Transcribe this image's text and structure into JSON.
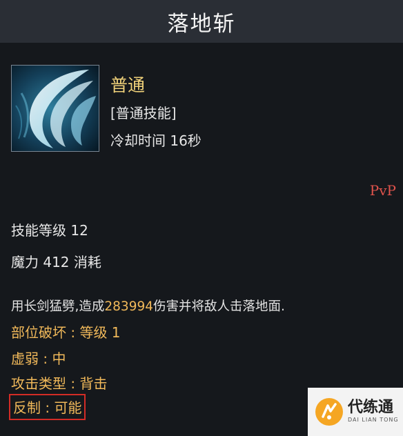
{
  "skill": {
    "title": "落地斩",
    "type": "普通",
    "class": "[普通技能]",
    "cooldown": "冷却时间 16秒",
    "pvp": "PvP"
  },
  "stats": {
    "level": "技能等级 12",
    "mana": "魔力 412 消耗"
  },
  "description": {
    "prefix": "用长剑猛劈,造成",
    "damage": "283994",
    "suffix": "伤害并将敌人击落地面."
  },
  "attributes": {
    "part_break": "部位破坏 : 等级 1",
    "weaken": "虚弱 : 中",
    "attack_type": "攻击类型 : 背击",
    "counter": "反制 : 可能"
  },
  "watermark": {
    "name_cn": "代练通",
    "name_en": "DAI LIAN TONG"
  },
  "colors": {
    "title_bar": "#2a2e35",
    "panel": "#15181c",
    "gold": "#f1d27a",
    "orange": "#f1b95a",
    "pvp_red": "#e0534c",
    "highlight_box": "#d32c26"
  },
  "icon": "sword-slash-skill-icon"
}
